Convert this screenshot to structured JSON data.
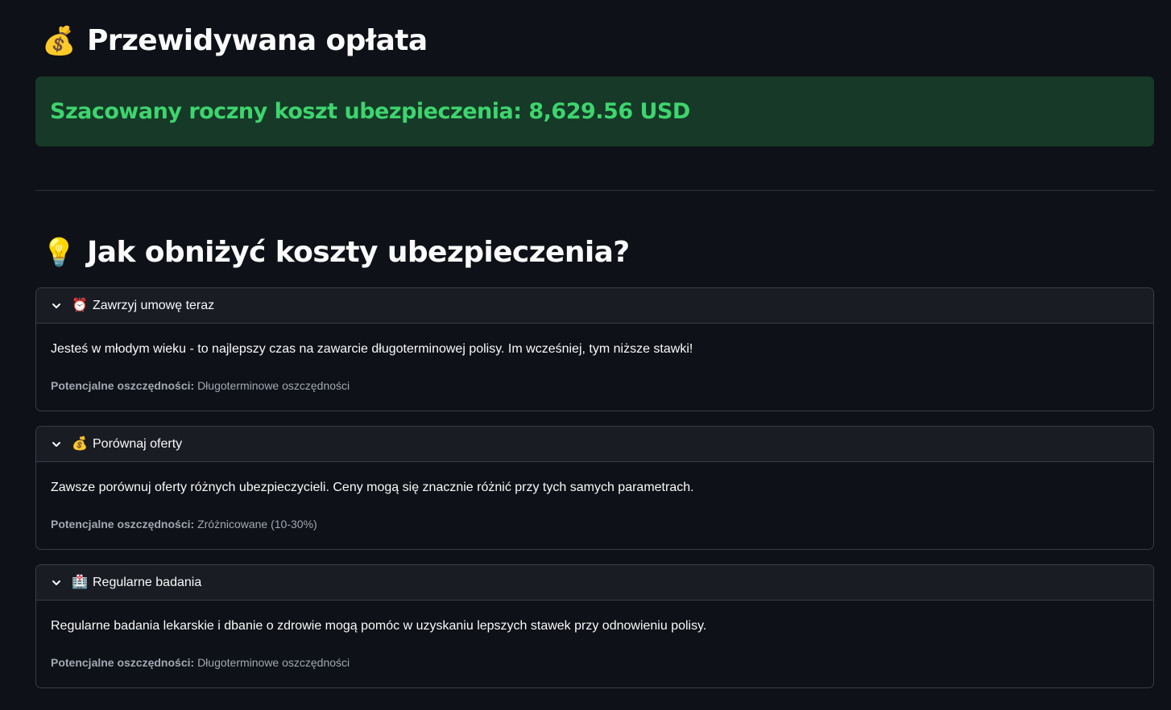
{
  "price_section": {
    "icon": "money-bag-icon",
    "emoji": "💰",
    "title": "Przewidywana opłata",
    "result_message": "Szacowany roczny koszt ubezpieczenia: 8,629.56 USD",
    "result_color": "#3dd56d",
    "result_background": "#173928"
  },
  "tips_section": {
    "icon": "light-bulb-icon",
    "emoji": "💡",
    "title": "Jak obniżyć koszty ubezpieczenia?",
    "savings_label": "Potencjalne oszczędności:",
    "tips": [
      {
        "icon": "alarm-clock-icon",
        "emoji": "⏰",
        "title": "Zawrzyj umowę teraz",
        "description": "Jesteś w młodym wieku - to najlepszy czas na zawarcie długoterminowej polisy. Im wcześniej, tym niższe stawki!",
        "savings": "Długoterminowe oszczędności",
        "expanded": true
      },
      {
        "icon": "money-bag-icon",
        "emoji": "💰",
        "title": "Porównaj oferty",
        "description": "Zawsze porównuj oferty różnych ubezpieczycieli. Ceny mogą się znacznie różnić przy tych samych parametrach.",
        "savings": "Zróżnicowane (10-30%)",
        "expanded": true
      },
      {
        "icon": "medical-record-icon",
        "emoji": "🏥",
        "title": "Regularne badania",
        "description": "Regularne badania lekarskie i dbanie o zdrowie mogą pomóc w uzyskaniu lepszych stawek przy odnowieniu polisy.",
        "savings": "Długoterminowe oszczędności",
        "expanded": true
      }
    ]
  },
  "theme": {
    "background": "#0e1117",
    "text": "#fafafa",
    "muted_text": "#a3a8b4",
    "border": "#3a3c48"
  }
}
